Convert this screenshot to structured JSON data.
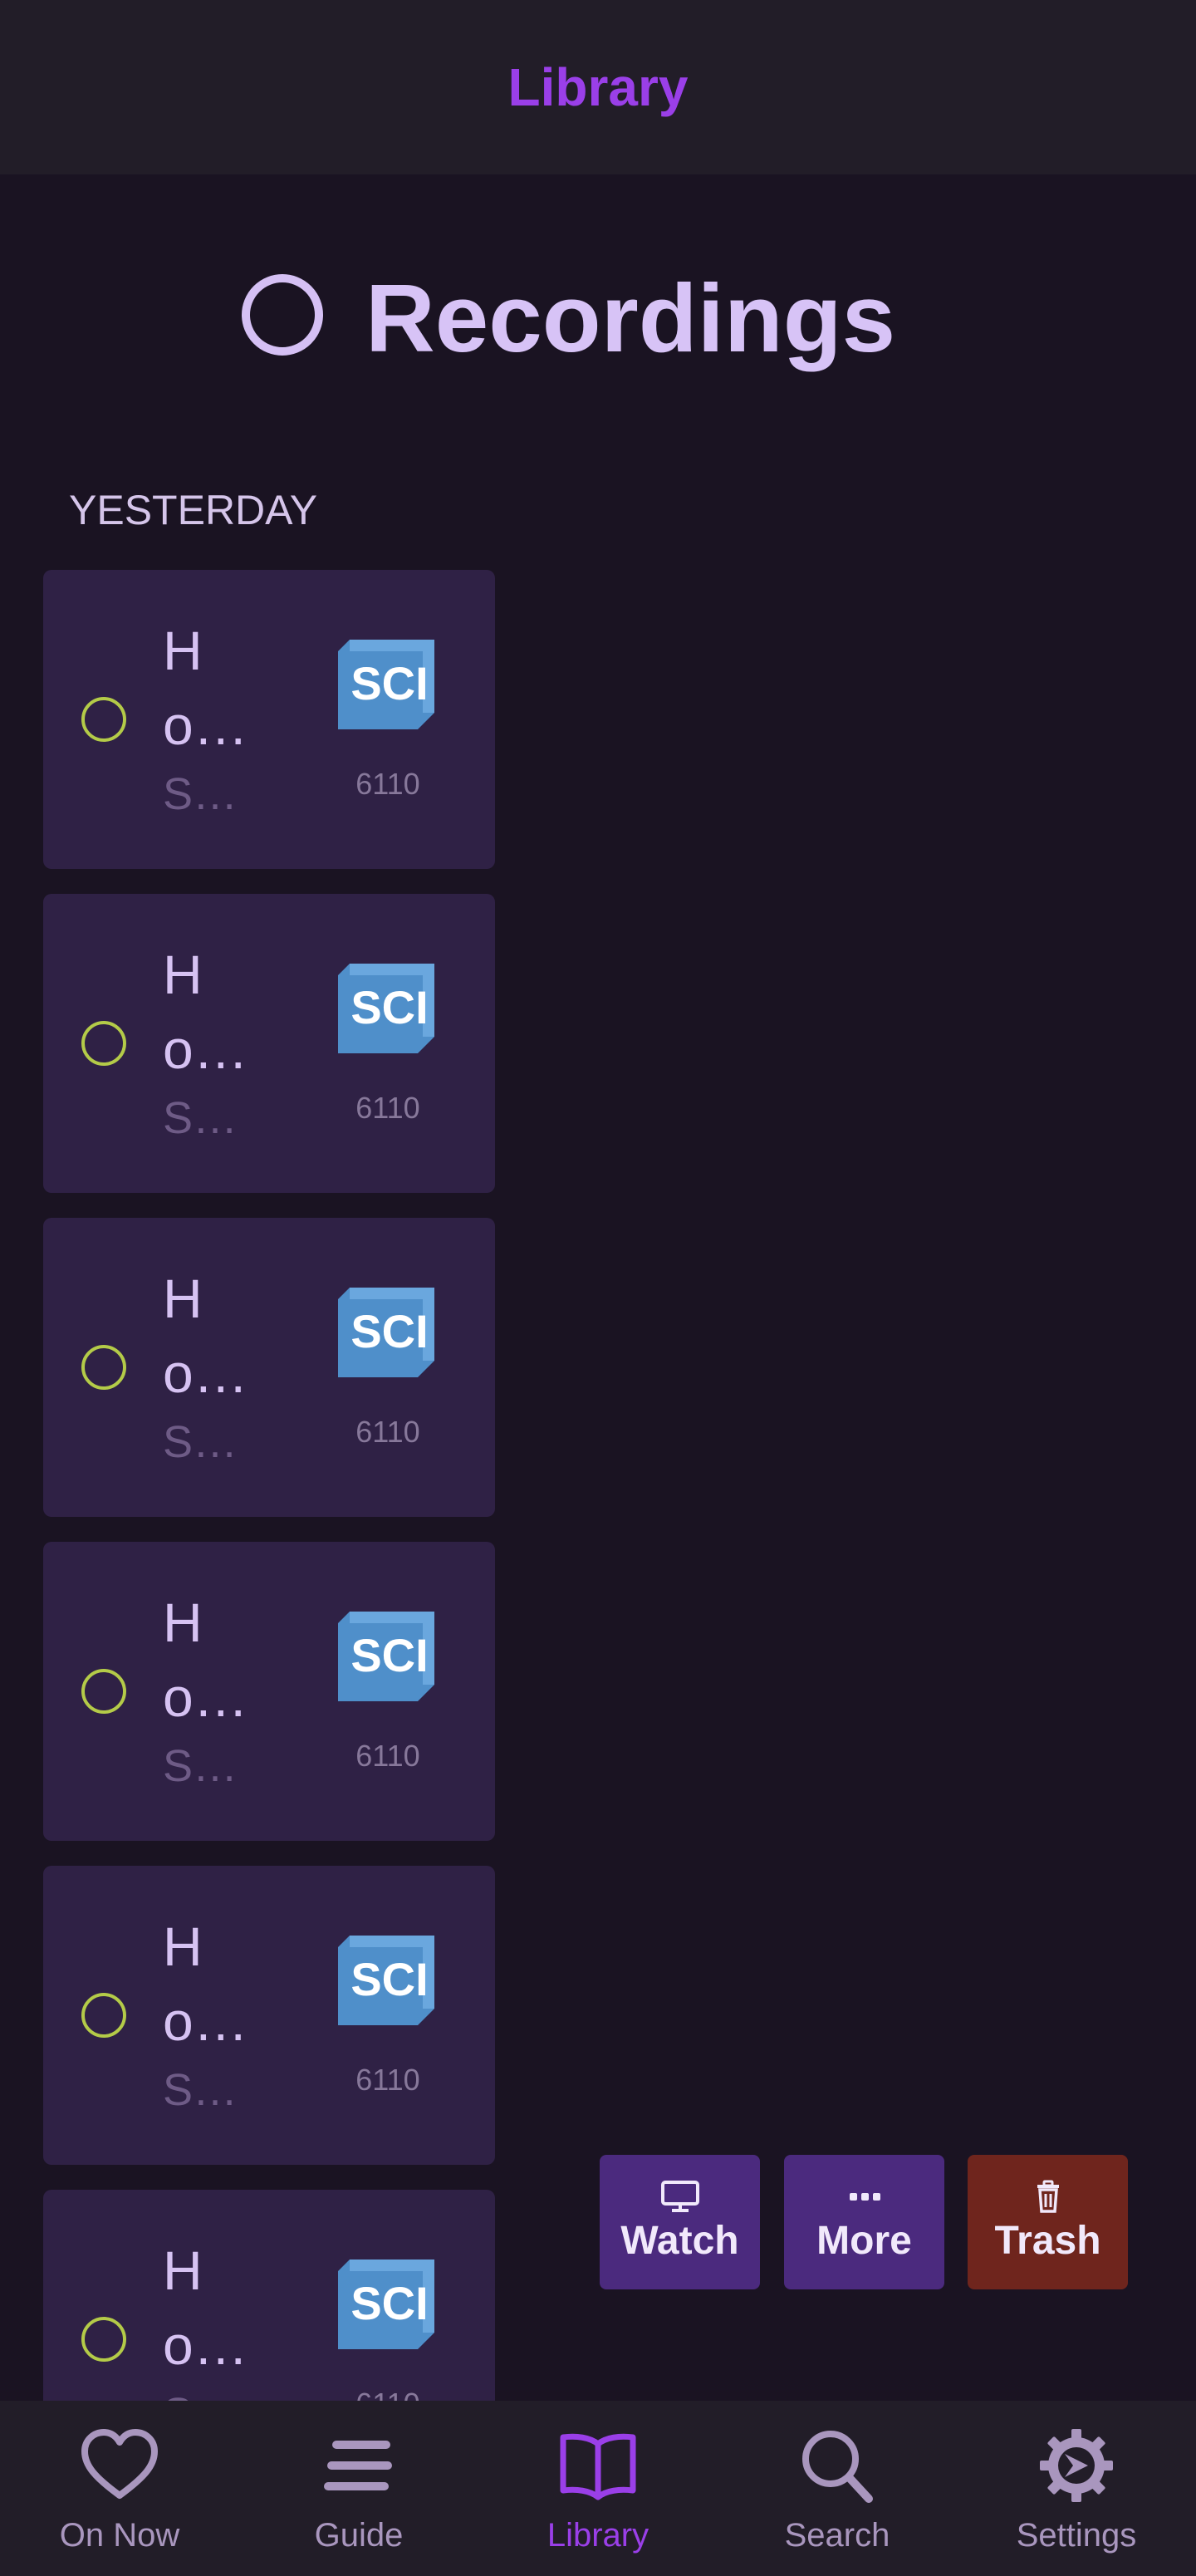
{
  "topbar": {
    "title": "Library"
  },
  "page": {
    "title": "Recordings",
    "section_label": "YESTERDAY"
  },
  "recordings": [
    {
      "title": "H\no…",
      "subtitle": "S…",
      "channel_logo": "SCI",
      "channel_number": "6110"
    },
    {
      "title": "H\no…",
      "subtitle": "S…",
      "channel_logo": "SCI",
      "channel_number": "6110"
    },
    {
      "title": "H\no…",
      "subtitle": "S…",
      "channel_logo": "SCI",
      "channel_number": "6110"
    },
    {
      "title": "H\no…",
      "subtitle": "S…",
      "channel_logo": "SCI",
      "channel_number": "6110"
    },
    {
      "title": "H\no…",
      "subtitle": "S…",
      "channel_logo": "SCI",
      "channel_number": "6110"
    },
    {
      "title": "H\no…",
      "subtitle": "S…",
      "channel_logo": "SCI",
      "channel_number": "6110"
    }
  ],
  "actions": {
    "watch": {
      "label": "Watch",
      "icon": "monitor-icon"
    },
    "more": {
      "label": "More",
      "icon": "ellipsis-icon"
    },
    "trash": {
      "label": "Trash",
      "icon": "trash-icon"
    }
  },
  "nav": {
    "items": [
      {
        "label": "On Now",
        "icon": "heart-icon",
        "active": false
      },
      {
        "label": "Guide",
        "icon": "menu-icon",
        "active": false
      },
      {
        "label": "Library",
        "icon": "book-icon",
        "active": true
      },
      {
        "label": "Search",
        "icon": "search-icon",
        "active": false
      },
      {
        "label": "Settings",
        "icon": "gear-icon",
        "active": false
      }
    ]
  },
  "colors": {
    "accent": "#9a3fe8",
    "card": "#2f2145",
    "trash": "#6f251d",
    "status_ring": "#b4cb48",
    "channel_logo": "#5b9bd5"
  }
}
